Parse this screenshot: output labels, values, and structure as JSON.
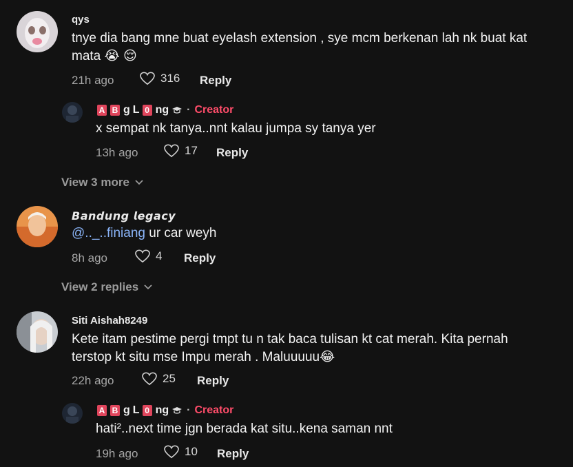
{
  "comments": [
    {
      "username": "qys",
      "text": "tnye dia bang mne buat eyelash extension , sye mcm berkenan lah nk buat kat mata 😭 😌",
      "time": "21h ago",
      "likes": "316",
      "reply_label": "Reply",
      "replies": [
        {
          "name_parts": [
            "A",
            "B",
            "g",
            "L",
            "0",
            "ng"
          ],
          "creator_tag": "Creator",
          "separator": "·",
          "text": "x sempat nk tanya..nnt kalau jumpa sy tanya yer",
          "time": "13h ago",
          "likes": "17",
          "reply_label": "Reply"
        }
      ],
      "view_more_label": "View 3 more"
    },
    {
      "username": "𝘽𝙖𝙣𝙙𝙪𝙣𝙜 𝙡𝙚𝙜𝙖𝙘𝙮",
      "mention": "@.._..finiang",
      "text": " ur car weyh",
      "time": "8h ago",
      "likes": "4",
      "reply_label": "Reply",
      "view_more_label": "View 2 replies"
    },
    {
      "username": "Siti Aishah8249",
      "text": "Kete itam pestime pergi tmpt tu n tak baca tulisan kt cat merah. Kita pernah terstop kt situ mse Impu merah . Maluuuuu😂",
      "time": "22h ago",
      "likes": "25",
      "reply_label": "Reply",
      "replies": [
        {
          "name_parts": [
            "A",
            "B",
            "g",
            "L",
            "0",
            "ng"
          ],
          "creator_tag": "Creator",
          "separator": "·",
          "text": "hati²..next time jgn berada kat situ..kena saman nnt",
          "time": "19h ago",
          "likes": "10",
          "reply_label": "Reply"
        }
      ]
    }
  ],
  "colors": {
    "background": "#121212",
    "creator_tag": "#ff4d6a",
    "mention": "#8ab4f8",
    "badge": "#e0455c"
  },
  "icons": [
    "heart-icon",
    "chevron-down-icon",
    "graduation-cap-icon"
  ]
}
